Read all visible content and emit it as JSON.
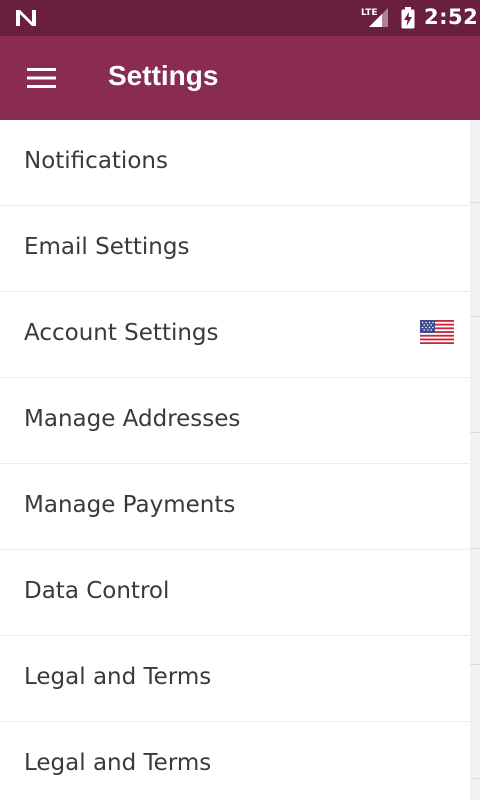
{
  "status_bar": {
    "network": "LTE",
    "time": "2:52",
    "icons": [
      "n-logo-icon",
      "lte-signal-icon",
      "battery-charging-icon"
    ]
  },
  "app_bar": {
    "title": "Settings",
    "menu_icon": "hamburger-menu-icon"
  },
  "settings": {
    "items": [
      {
        "label": "Notifications"
      },
      {
        "label": "Email Settings"
      },
      {
        "label": "Account Settings",
        "icon": "us-flag-icon"
      },
      {
        "label": "Manage Addresses"
      },
      {
        "label": "Manage Payments"
      },
      {
        "label": "Data Control"
      },
      {
        "label": "Legal and Terms"
      },
      {
        "label": "Legal and Terms"
      }
    ]
  },
  "colors": {
    "status_bar": "#6a1f3f",
    "app_bar": "#8a2b52",
    "text": "#3a3a3a",
    "divider": "#ececec"
  }
}
